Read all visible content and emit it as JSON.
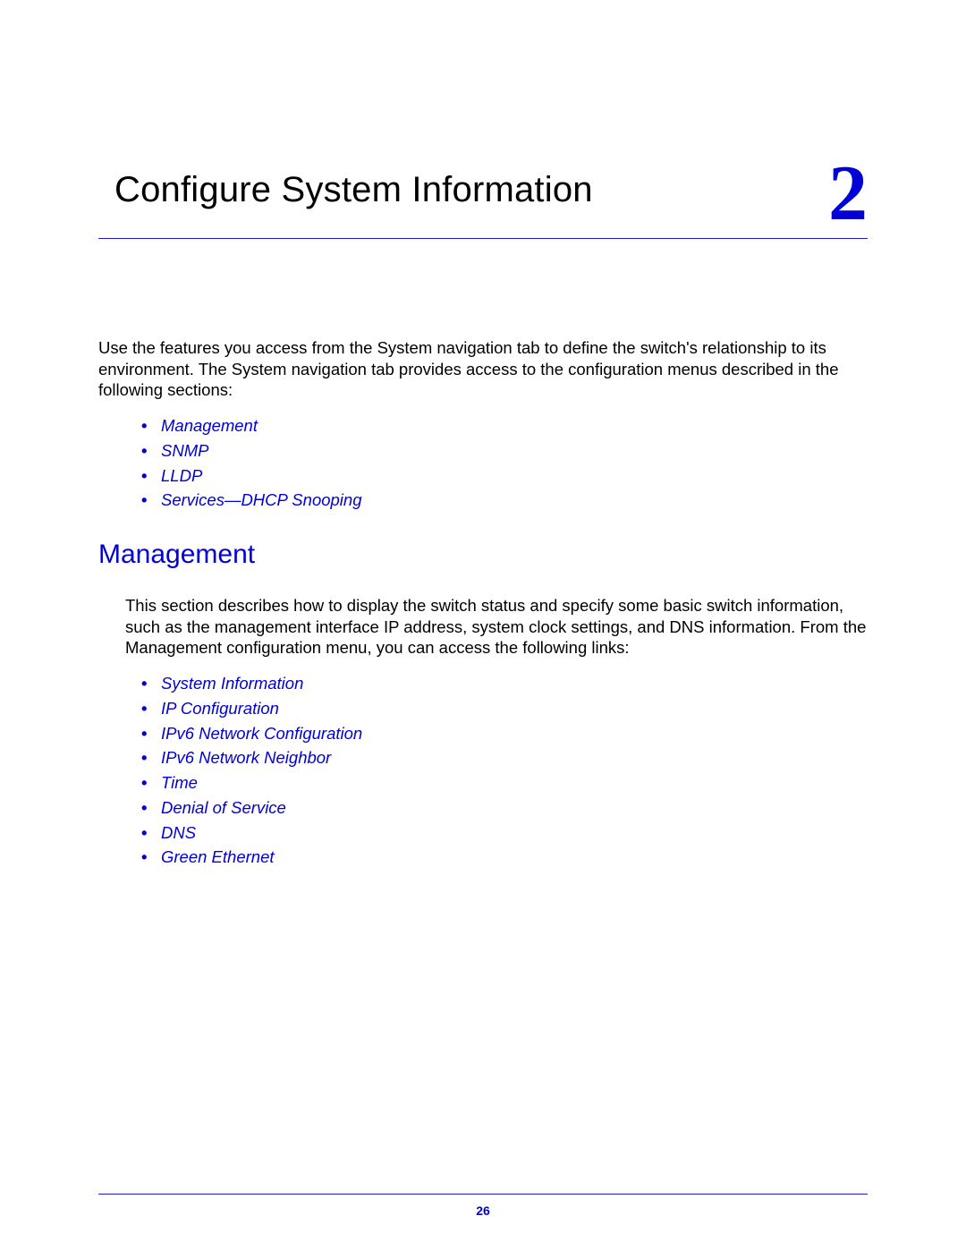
{
  "chapter": {
    "title": "Configure System Information",
    "number": "2"
  },
  "intro_paragraph": "Use the features you access from the System navigation tab to define the switch's relationship to its environment. The System navigation tab provides access to the configuration menus described in the following sections:",
  "intro_links": [
    "Management",
    "SNMP",
    "LLDP",
    "Services—DHCP Snooping"
  ],
  "section": {
    "heading": "Management",
    "body": "This section describes how to display the switch status and specify some basic switch information, such as the management interface IP address, system clock settings, and DNS information. From the Management configuration menu, you can access the following links:",
    "links": [
      "System Information",
      "IP Configuration",
      "IPv6 Network Configuration",
      "IPv6 Network Neighbor",
      "Time",
      "Denial of Service",
      "DNS",
      "Green Ethernet"
    ]
  },
  "page_number": "26"
}
